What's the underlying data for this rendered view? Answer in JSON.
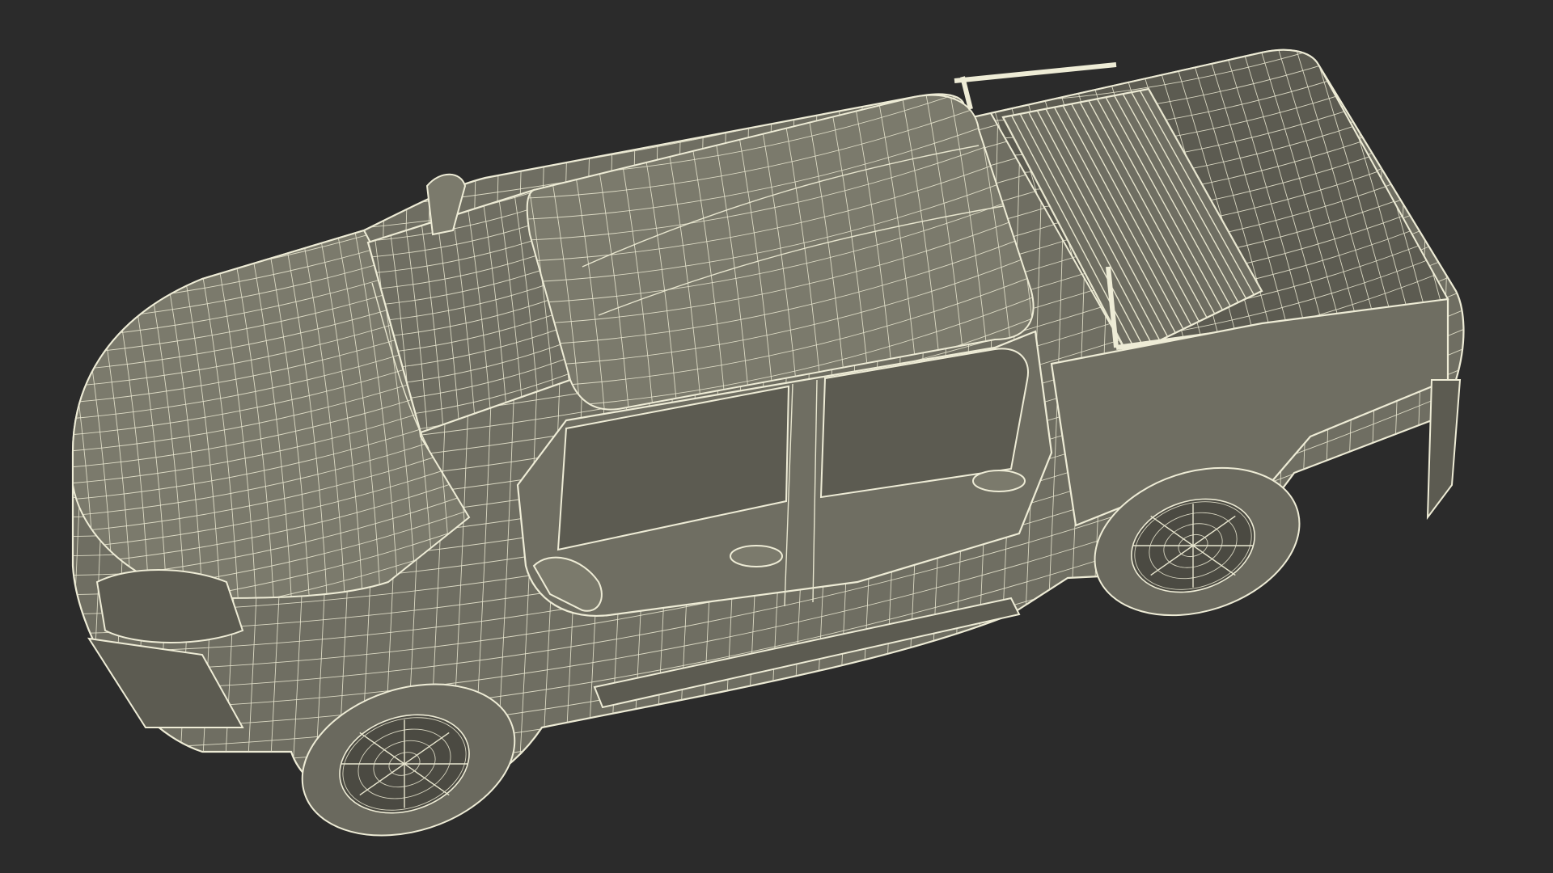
{
  "scene": {
    "subject": "pickup-truck-wireframe",
    "background_color": "#2b2b2b",
    "wire_color": "#e8e6cf",
    "surface_color": "#6f6e62"
  }
}
